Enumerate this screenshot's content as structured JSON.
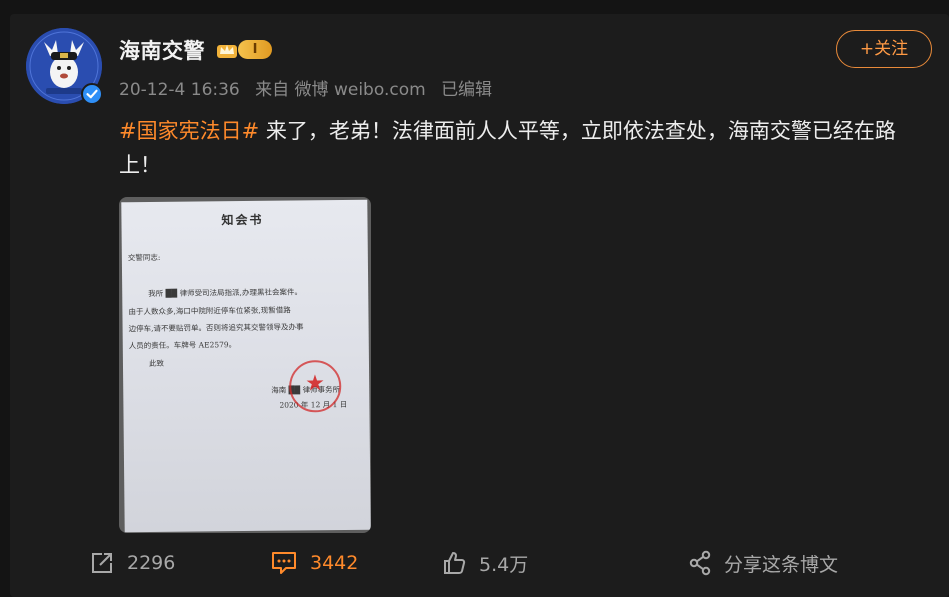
{
  "user": {
    "name": "海南交警",
    "level": "I"
  },
  "meta": {
    "time": "20-12-4 16:36",
    "source": "来自 微博 weibo.com",
    "edited": "已编辑"
  },
  "follow_label": "+关注",
  "post": {
    "topic": "#国家宪法日#",
    "body": " 来了，老弟！法律面前人人平等，立即依法查处，海南交警已经在路上！"
  },
  "photo_doc": {
    "title": "知会书",
    "salutation": "交警同志:",
    "lines": [
      "我所 ██ 律师受司法局指派,办理黑社会案件。",
      "由于人数众多,海口中院附近停车位紧张,现暂借路",
      "边停车,请不要贴罚单。否则将追究其交警领导及办事",
      "人员的责任。车牌号 AE2579。"
    ],
    "closing": "此致",
    "sign": "海南 ██ 律师事务所",
    "date": "2020 年 12 月 1 日"
  },
  "actions": {
    "forward_count": "2296",
    "comment_count": "3442",
    "like_count": "5.4万",
    "share_label": "分享这条博文"
  },
  "colors": {
    "accent": "#ff8a2b",
    "background": "#1c1c1c",
    "verified": "#2f8ff7"
  }
}
